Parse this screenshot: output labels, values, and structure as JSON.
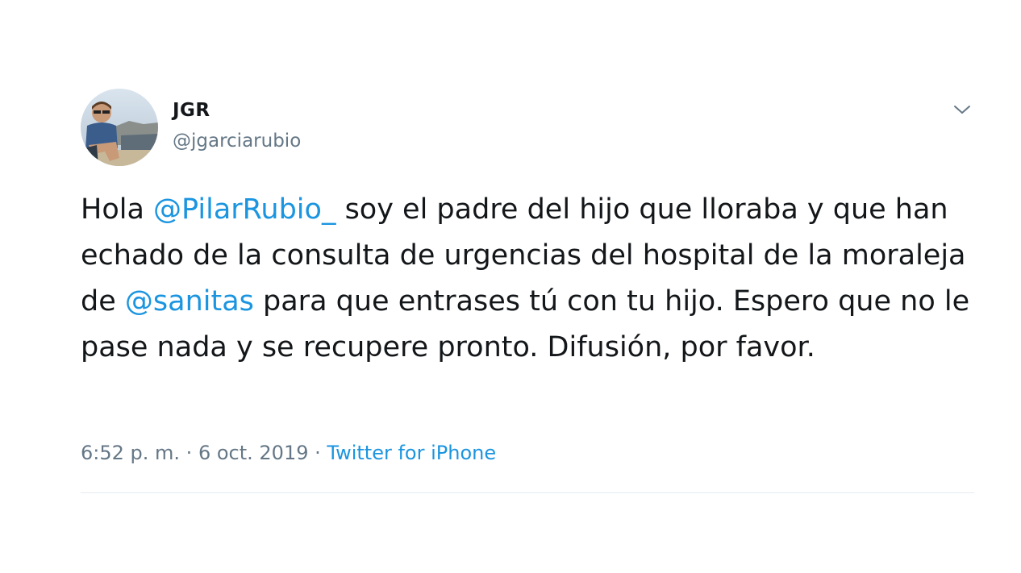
{
  "author": {
    "display_name": "JGR",
    "handle": "@jgarciarubio",
    "avatar_icon": "profile-photo"
  },
  "menu": {
    "icon": "chevron-down-icon"
  },
  "tweet": {
    "segments": [
      {
        "type": "text",
        "text": "Hola "
      },
      {
        "type": "mention",
        "text": "@PilarRubio_"
      },
      {
        "type": "text",
        "text": " soy el padre del hijo que lloraba y que han echado de la consulta de urgencias del hospital de la moraleja de "
      },
      {
        "type": "mention",
        "text": "@sanitas"
      },
      {
        "type": "text",
        "text": " para que entrases tú con tu hijo. Espero que no le pase nada y se recupere pronto. Difusión, por favor."
      }
    ]
  },
  "meta": {
    "time": "6:52 p. m.",
    "separator": "·",
    "date": "6 oct. 2019",
    "source": "Twitter for iPhone"
  },
  "colors": {
    "text": "#14171a",
    "secondary": "#657786",
    "link": "#1b95e0",
    "divider": "#e6ecf0"
  }
}
